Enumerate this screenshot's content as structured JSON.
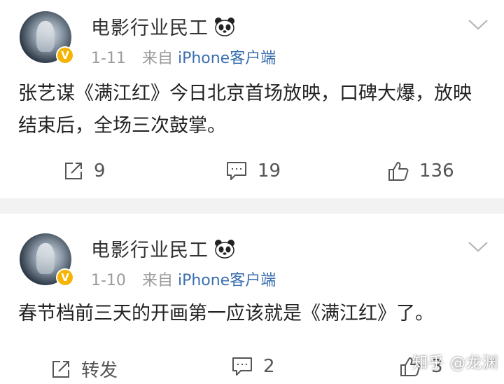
{
  "posts": [
    {
      "username": "电影行业民工",
      "date": "1-11",
      "source_prefix": "来自",
      "source_client": "iPhone客户端",
      "text": "张艺谋《满江红》今日北京首场放映，口碑大爆，放映结束后，全场三次鼓掌。",
      "actions": {
        "repost": "9",
        "comments": "19",
        "likes": "136"
      }
    },
    {
      "username": "电影行业民工",
      "date": "1-10",
      "source_prefix": "来自",
      "source_client": "iPhone客户端",
      "text": "春节档前三天的开画第一应该就是《满江红》了。",
      "actions": {
        "repost": "转发",
        "comments": "2",
        "likes": "3"
      }
    }
  ],
  "verified_badge": "V",
  "watermark": "知乎 @龙渊",
  "colors": {
    "link": "#3b6fb0",
    "meta": "#9a9a9a",
    "badge": "#f6b300",
    "divider": "#f2f2f2"
  }
}
